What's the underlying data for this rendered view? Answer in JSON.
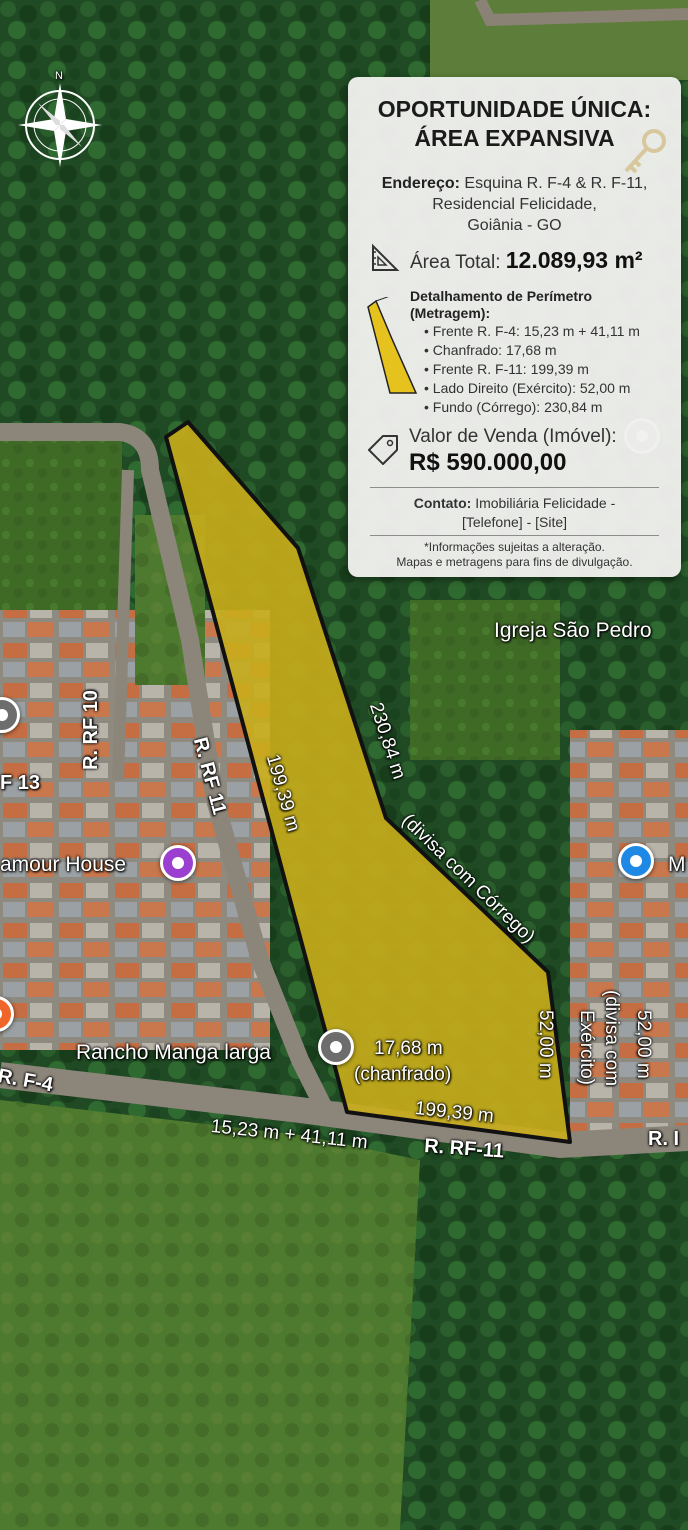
{
  "colors": {
    "plot_fill": "#c9ad1b",
    "plot_stroke": "#111111",
    "card_bg": "#f0f0ee",
    "pin_grey": "#6d6d6d",
    "pin_purple": "#9b3fd1",
    "pin_blue": "#1e88e5",
    "pin_orange": "#f0662a"
  },
  "compass": {
    "north_label": "N",
    "icon": "compass-rose-icon"
  },
  "card": {
    "title_line1": "OPORTUNIDADE ÚNICA:",
    "title_line2": "ÁREA EXPANSIVA",
    "title_icon": "key-icon",
    "address_label": "Endereço:",
    "address_line1": "Esquina R. F-4 & R. F-11,",
    "address_line2": "Residencial Felicidade,",
    "address_line3": "Goiânia - GO",
    "area_icon": "set-square-icon",
    "area_label": "Área Total:",
    "area_value": "12.089,93 m²",
    "perimeter_icon": "plot-shape-icon",
    "perimeter_heading_line1": "Detalhamento de Perímetro",
    "perimeter_heading_line2": "(Metragem):",
    "perimeter_items": [
      "Frente R. F-4: 15,23 m + 41,11 m",
      "Chanfrado: 17,68 m",
      "Frente R. F-11: 199,39 m",
      "Lado Direito (Exército): 52,00 m",
      "Fundo (Córrego): 230,84 m"
    ],
    "price_icon": "price-tag-icon",
    "price_label": "Valor de Venda (Imóvel):",
    "price_value": "R$ 590.000,00",
    "contact_label": "Contato:",
    "contact_line1": "Imobiliária Felicidade -",
    "contact_line2": "[Telefone] - [Site]",
    "disclaimer_line1": "*Informações sujeitas a alteração.",
    "disclaimer_line2": "Mapas e metragens para fins de divulgação."
  },
  "map_labels": {
    "church": "Igreja São Pedro",
    "glamour": "amour House",
    "rancho": "Rancho Manga larga",
    "right_edge_poi": "M",
    "street_rf13": "F 13",
    "street_rf10": "R. RF 10",
    "street_rf11_vertical": "R. RF 11",
    "street_f4": "R. F-4",
    "street_rf11_bottom": "R. RF-11",
    "street_right_edge": "R. I"
  },
  "dimensions": {
    "left_side": "199,39 m",
    "top_diagonal": "230,84 m",
    "top_diagonal_note": "(divisa com Córrego)",
    "chamfer_value": "17,68 m",
    "chamfer_note": "(chanfrado)",
    "right_inside": "52,00 m",
    "right_outside": "52,00 m",
    "right_note_line1": "(divisa com",
    "right_note_line2": "Exército)",
    "bottom_inside": "199,39 m",
    "bottom_front": "15,23 m + 41,11 m"
  }
}
